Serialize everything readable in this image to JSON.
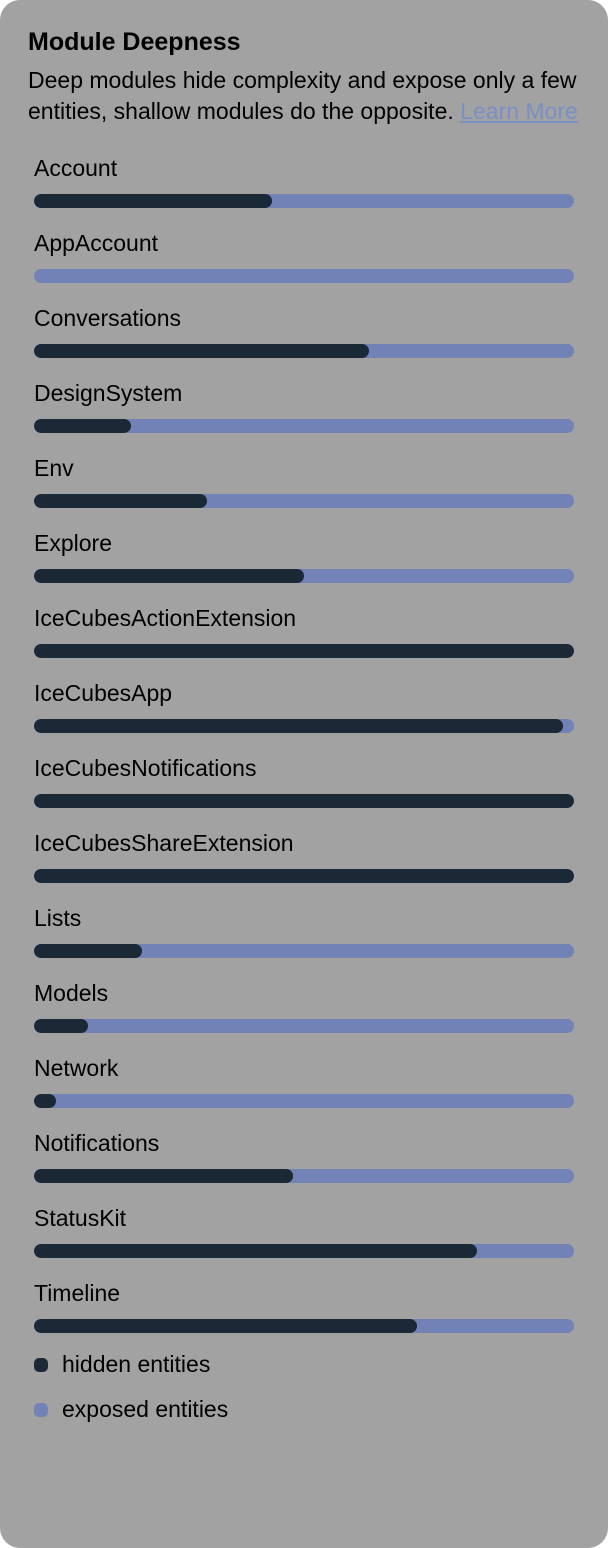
{
  "title": "Module Deepness",
  "description_prefix": "Deep modules hide complexity and expose only a few entities, shallow modules do the opposite. ",
  "learn_more_label": "Learn More",
  "legend": {
    "hidden": {
      "label": "hidden entities",
      "color": "#1b2836"
    },
    "exposed": {
      "label": "exposed entities",
      "color": "#7281b6"
    }
  },
  "chart_data": {
    "type": "bar",
    "title": "Module Deepness",
    "xlabel": "",
    "ylabel": "",
    "categories": [
      "Account",
      "AppAccount",
      "Conversations",
      "DesignSystem",
      "Env",
      "Explore",
      "IceCubesActionExtension",
      "IceCubesApp",
      "IceCubesNotifications",
      "IceCubesShareExtension",
      "Lists",
      "Models",
      "Network",
      "Notifications",
      "StatusKit",
      "Timeline"
    ],
    "series": [
      {
        "name": "hidden entities",
        "values": [
          44,
          0,
          62,
          18,
          32,
          50,
          100,
          98,
          100,
          100,
          20,
          10,
          4,
          48,
          82,
          71
        ]
      },
      {
        "name": "exposed entities",
        "values": [
          56,
          100,
          38,
          82,
          68,
          50,
          0,
          2,
          0,
          0,
          80,
          90,
          96,
          52,
          18,
          29
        ]
      }
    ],
    "unit": "percent_of_total",
    "ylim": [
      0,
      100
    ]
  }
}
